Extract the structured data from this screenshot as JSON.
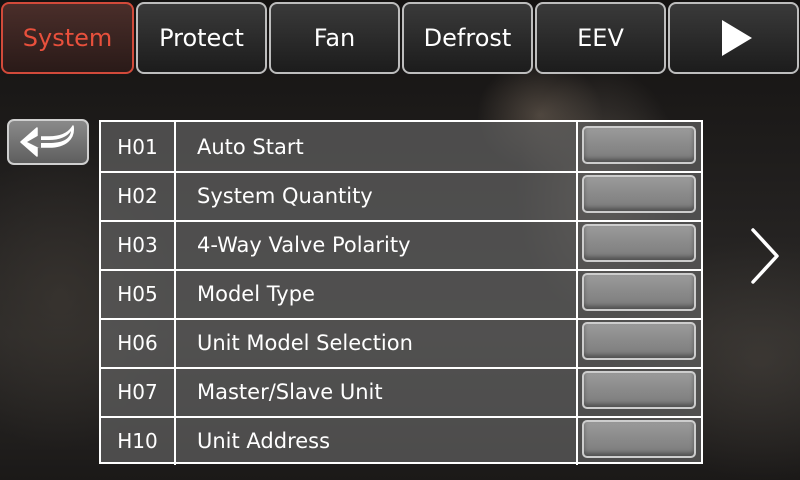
{
  "tabs": [
    {
      "label": "System",
      "active": true
    },
    {
      "label": "Protect",
      "active": false
    },
    {
      "label": "Fan",
      "active": false
    },
    {
      "label": "Defrost",
      "active": false
    },
    {
      "label": "EEV",
      "active": false
    }
  ],
  "icons": {
    "tab_next": "play-icon",
    "back": "return-arrow-icon",
    "next_page": "chevron-right-icon"
  },
  "colors": {
    "active_tab_text": "#e8503c",
    "active_tab_border": "#d24a3a",
    "table_border": "#ffffff"
  },
  "parameters": [
    {
      "code": "H01",
      "label": "Auto Start",
      "value": ""
    },
    {
      "code": "H02",
      "label": "System Quantity",
      "value": ""
    },
    {
      "code": "H03",
      "label": "4-Way Valve Polarity",
      "value": ""
    },
    {
      "code": "H05",
      "label": "Model Type",
      "value": ""
    },
    {
      "code": "H06",
      "label": "Unit Model Selection",
      "value": ""
    },
    {
      "code": "H07",
      "label": "Master/Slave Unit",
      "value": ""
    },
    {
      "code": "H10",
      "label": "Unit Address",
      "value": ""
    }
  ]
}
